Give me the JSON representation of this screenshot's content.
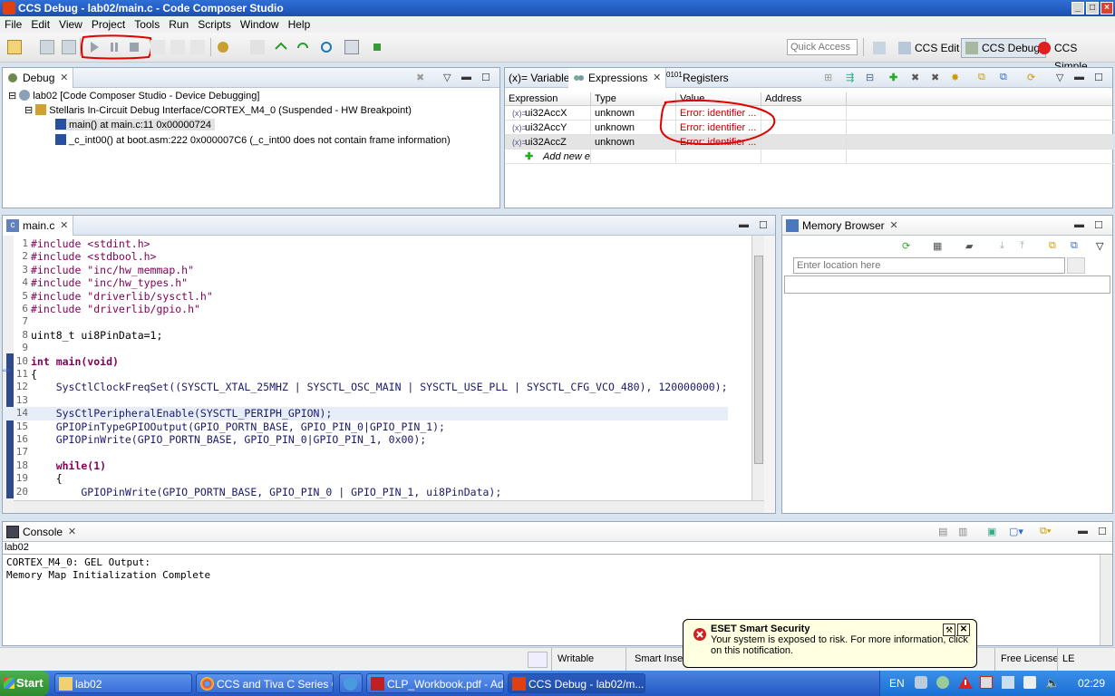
{
  "window": {
    "title": "CCS Debug - lab02/main.c - Code Composer Studio"
  },
  "menu": [
    "File",
    "Edit",
    "View",
    "Project",
    "Tools",
    "Run",
    "Scripts",
    "Window",
    "Help"
  ],
  "toolbar": {
    "quick_access_placeholder": "Quick Access"
  },
  "perspectives": [
    {
      "label": "CCS Edit"
    },
    {
      "label": "CCS Debug"
    },
    {
      "label": "CCS Simple"
    }
  ],
  "debug_view": {
    "tab": "Debug",
    "tree": [
      "lab02 [Code Composer Studio - Device Debugging]",
      "Stellaris In-Circuit Debug Interface/CORTEX_M4_0 (Suspended - HW Breakpoint)",
      "main() at main.c:11 0x00000724",
      "_c_int00() at boot.asm:222 0x000007C6  (_c_int00 does not contain frame information)"
    ]
  },
  "expressions_view": {
    "tabs": [
      "(x)= Variables",
      "Expressions",
      "Registers"
    ],
    "columns": [
      "Expression",
      "Type",
      "Value",
      "Address"
    ],
    "rows": [
      {
        "expression": "ui32AccX",
        "type": "unknown",
        "value": "Error: identifier ..."
      },
      {
        "expression": "ui32AccY",
        "type": "unknown",
        "value": "Error: identifier ..."
      },
      {
        "expression": "ui32AccZ",
        "type": "unknown",
        "value": "Error: identifier ..."
      }
    ],
    "add_new": "Add new ex"
  },
  "editor": {
    "tab": "main.c",
    "lines": [
      {
        "n": "1",
        "text": "#include <stdint.h>"
      },
      {
        "n": "2",
        "text": "#include <stdbool.h>"
      },
      {
        "n": "3",
        "text": "#include \"inc/hw_memmap.h\""
      },
      {
        "n": "4",
        "text": "#include \"inc/hw_types.h\""
      },
      {
        "n": "5",
        "text": "#include \"driverlib/sysctl.h\""
      },
      {
        "n": "6",
        "text": "#include \"driverlib/gpio.h\""
      },
      {
        "n": "7",
        "text": ""
      },
      {
        "n": "8",
        "text": "uint8_t ui8PinData=1;"
      },
      {
        "n": "9",
        "text": ""
      },
      {
        "n": "10",
        "text": "int main(void)"
      },
      {
        "n": "11",
        "text": "{"
      },
      {
        "n": "12",
        "text": "    SysCtlClockFreqSet((SYSCTL_XTAL_25MHZ | SYSCTL_OSC_MAIN | SYSCTL_USE_PLL | SYSCTL_CFG_VCO_480), 120000000);"
      },
      {
        "n": "13",
        "text": ""
      },
      {
        "n": "14",
        "text": "    SysCtlPeripheralEnable(SYSCTL_PERIPH_GPION);"
      },
      {
        "n": "15",
        "text": "    GPIOPinTypeGPIOOutput(GPIO_PORTN_BASE, GPIO_PIN_0|GPIO_PIN_1);"
      },
      {
        "n": "16",
        "text": "    GPIOPinWrite(GPIO_PORTN_BASE, GPIO_PIN_0|GPIO_PIN_1, 0x00);"
      },
      {
        "n": "17",
        "text": ""
      },
      {
        "n": "18",
        "text": "    while(1)"
      },
      {
        "n": "19",
        "text": "    {"
      },
      {
        "n": "20",
        "text": "        GPIOPinWrite(GPIO_PORTN_BASE, GPIO_PIN_0 | GPIO_PIN_1, ui8PinData);"
      }
    ]
  },
  "memory_browser": {
    "tab": "Memory Browser",
    "location_placeholder": "Enter location here"
  },
  "console": {
    "tab": "Console",
    "context": "lab02",
    "lines": [
      "CORTEX_M4_0: GEL Output:",
      "Memory Map Initialization Complete"
    ]
  },
  "statusbar": {
    "writable": "Writable",
    "insert": "Smart Insert",
    "license": "Free License",
    "le": "LE"
  },
  "eset": {
    "title": "ESET Smart Security",
    "message": "Your system is exposed to risk. For more information, click on this notification."
  },
  "taskbar": {
    "start": "Start",
    "items": [
      "lab02",
      "CCS and Tiva C Series C...",
      "CLP_Workbook.pdf - Ad...",
      "CCS Debug - lab02/m..."
    ],
    "lang": "EN",
    "clock": "02:29"
  },
  "colors": {
    "accent": "#2f6fd6",
    "error": "#c00000",
    "annotation": "#e00000",
    "keyword": "#7f0055",
    "string": "#2a00ff"
  }
}
